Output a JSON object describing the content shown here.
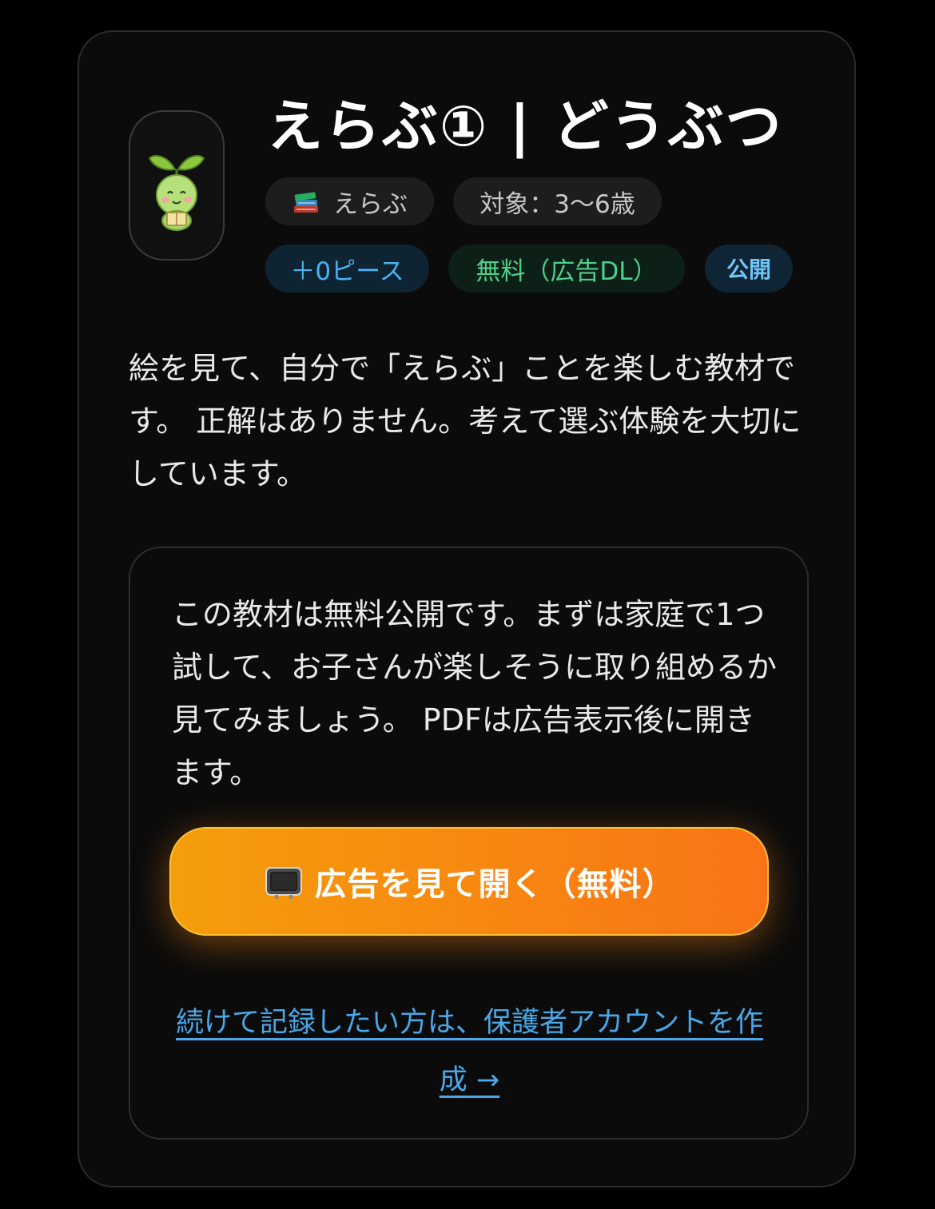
{
  "header": {
    "title": "えらぶ① | どうぶつ",
    "mascot_icon": "sprout-mascot-reading-icon"
  },
  "chips": {
    "category": {
      "icon": "books-icon",
      "label": "えらぶ"
    },
    "age": {
      "label": "対象：3〜6歳"
    },
    "pieces": {
      "label": "＋0ピース"
    },
    "price": {
      "label": "無料（広告DL）"
    },
    "visibility": {
      "label": "公開"
    }
  },
  "description": "絵を見て、自分で「えらぶ」ことを楽しむ教材です。 正解はありません。考えて選ぶ体験を大切にしています。",
  "panel": {
    "note": "この教材は無料公開です。まずは家庭で1つ試して、お子さんが楽しそうに取り組めるか見てみましょう。 PDFは広告表示後に開きます。",
    "cta": {
      "icon": "tv-icon",
      "label": "広告を見て開く（無料）"
    },
    "signup_link": "続けて記録したい方は、保護者アカウントを作成 →"
  },
  "colors": {
    "background": "#000000",
    "card": "#0b0b0b",
    "cta_gradient_start": "#f59e0b",
    "cta_gradient_end": "#f97316",
    "link": "#4aa7e8",
    "chip_blue_text": "#4ab2ee",
    "chip_green_text": "#4fd08b"
  }
}
